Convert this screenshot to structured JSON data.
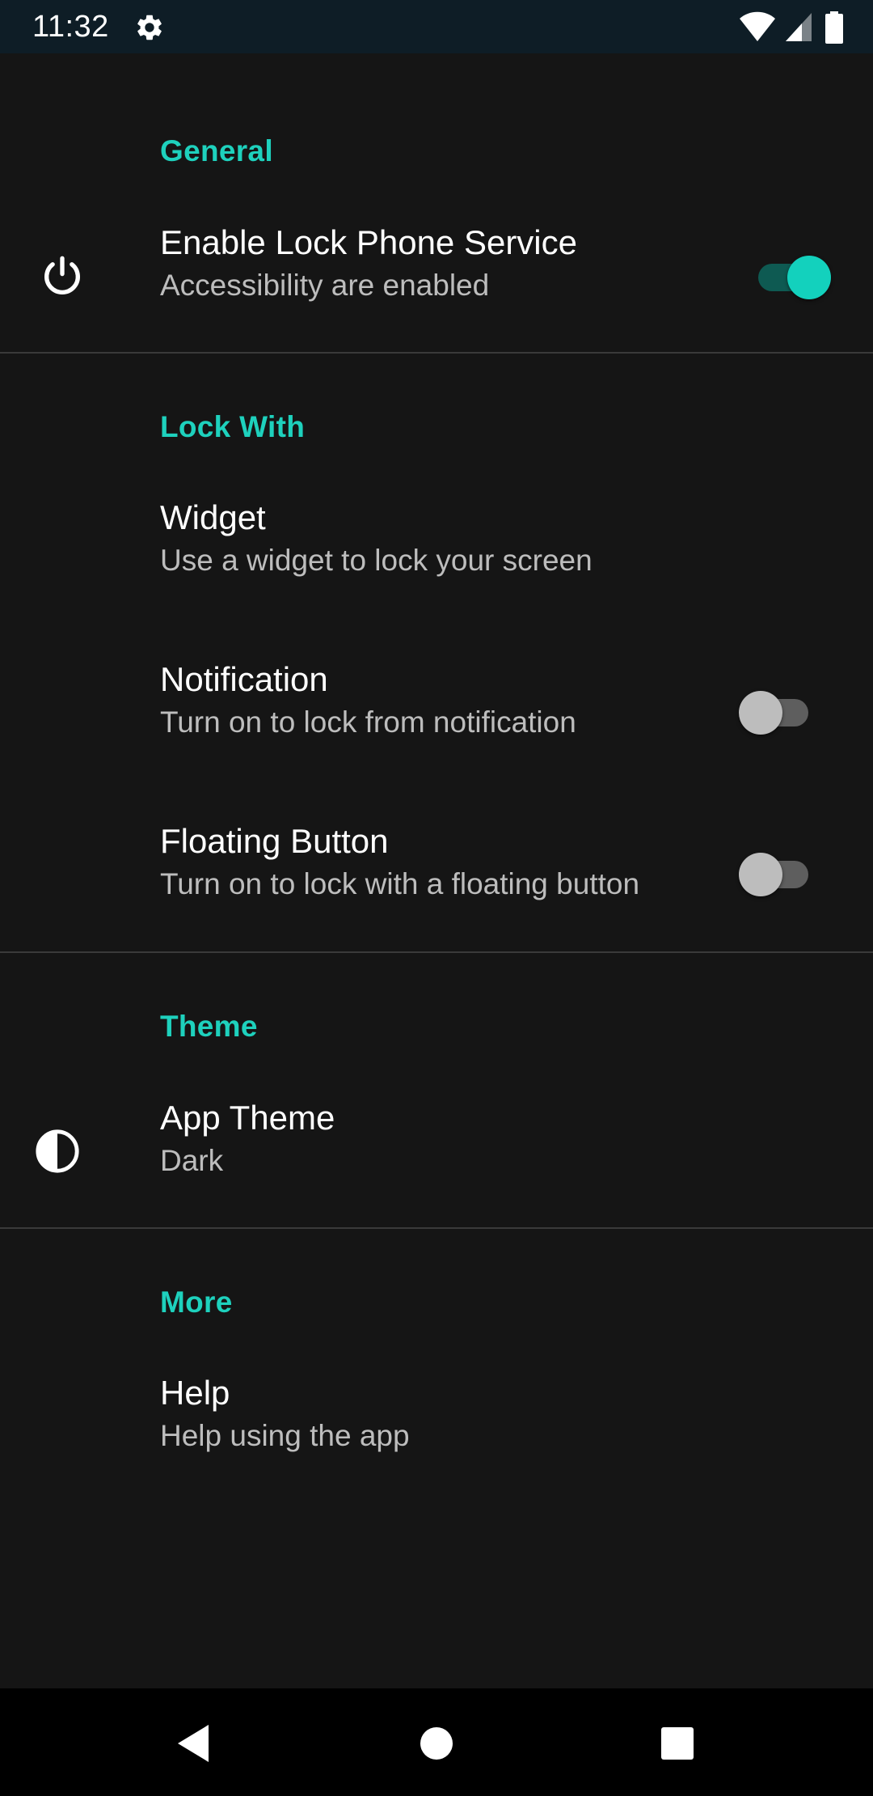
{
  "status_bar": {
    "time": "11:32",
    "icons": [
      "gear-icon",
      "wifi-icon",
      "cell-signal-icon",
      "battery-icon"
    ]
  },
  "colors": {
    "accent": "#1ed1bd",
    "background": "#151515",
    "status_bar": "#0e1d26",
    "switch_on_thumb": "#13d1bd",
    "switch_off_thumb": "#bdbdbd"
  },
  "sections": {
    "general": {
      "header": "General",
      "lock_service": {
        "icon": "power-icon",
        "title": "Enable Lock Phone Service",
        "summary": "Accessibility are enabled",
        "enabled": true
      }
    },
    "lock_with": {
      "header": "Lock With",
      "widget": {
        "title": "Widget",
        "summary": "Use a widget to lock your screen"
      },
      "notification": {
        "title": "Notification",
        "summary": "Turn on to lock from notification",
        "enabled": false
      },
      "floating_button": {
        "title": "Floating Button",
        "summary": "Turn on to lock with a floating button",
        "enabled": false
      }
    },
    "theme": {
      "header": "Theme",
      "app_theme": {
        "icon": "contrast-icon",
        "title": "App Theme",
        "summary": "Dark"
      }
    },
    "more": {
      "header": "More",
      "help": {
        "title": "Help",
        "summary": "Help using the app"
      }
    }
  },
  "nav_bar": {
    "buttons": [
      "back-icon",
      "home-icon",
      "recents-icon"
    ]
  }
}
